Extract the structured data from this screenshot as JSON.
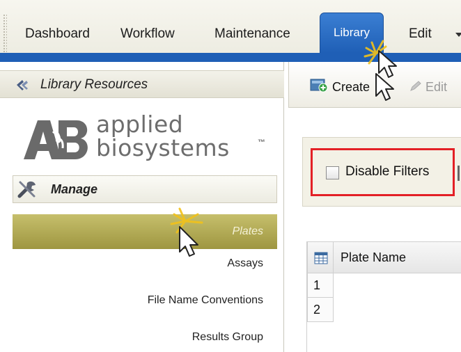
{
  "menubar": {
    "items": [
      "Dashboard",
      "Workflow",
      "Maintenance",
      "Library",
      "Edit"
    ],
    "active_tab": "Library",
    "accent_color": "#1f5fb6"
  },
  "library_panel": {
    "title": "Library Resources",
    "icon": "library-resources-icon"
  },
  "brand": {
    "logo_line1": "applied",
    "logo_line2": "biosystems",
    "trademark": "™"
  },
  "manage": {
    "title": "Manage",
    "icon": "wrench-icon",
    "items": [
      {
        "label": "Plates",
        "selected": true
      },
      {
        "label": "Assays",
        "selected": false
      },
      {
        "label": "File Name Conventions",
        "selected": false
      },
      {
        "label": "Results Group",
        "selected": false
      }
    ],
    "selected_color": "#b1aa55"
  },
  "toolbar": {
    "create_label": "Create",
    "edit_label": "Edit"
  },
  "filters": {
    "disable_filters_label": "Disable Filters",
    "disable_filters_checked": false,
    "highlight_color": "#e32026"
  },
  "grid": {
    "columns": [
      "Plate Name"
    ],
    "rows": [
      "1",
      "2"
    ]
  }
}
